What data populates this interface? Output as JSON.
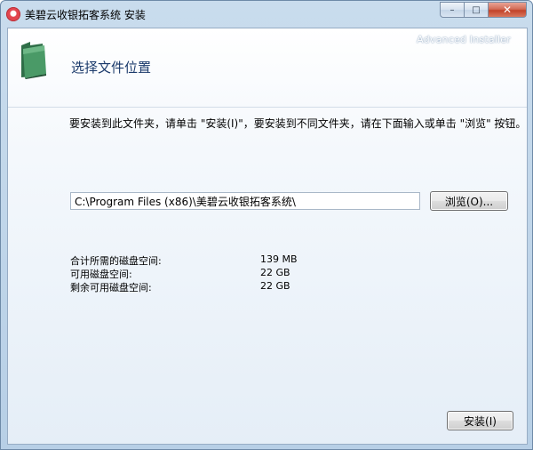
{
  "window": {
    "title": "美碧云收银拓客系统 安装",
    "buttons": {
      "minimize": "–",
      "maximize": "□",
      "close": "✕"
    }
  },
  "header": {
    "title": "选择文件位置",
    "brand": "Advanced Installer"
  },
  "instruction": "要安装到此文件夹，请单击 \"安装(I)\"，要安装到不同文件夹，请在下面输入或单击 \"浏览\" 按钮。",
  "path": {
    "value": "C:\\Program Files (x86)\\美碧云收银拓客系统\\",
    "browse_label": "浏览(O)..."
  },
  "space": [
    {
      "label": "合计所需的磁盘空间:",
      "value": "139 MB"
    },
    {
      "label": "可用磁盘空间:",
      "value": "22 GB"
    },
    {
      "label": "剩余可用磁盘空间:",
      "value": "22 GB"
    }
  ],
  "footer": {
    "install_label": "安装(I)"
  },
  "colors": {
    "title": "#1b3a6b",
    "accent": "#c2432a",
    "folder": "#3d8a5a"
  },
  "icons": {
    "app": "app-logo-icon",
    "header": "folder-icon"
  }
}
